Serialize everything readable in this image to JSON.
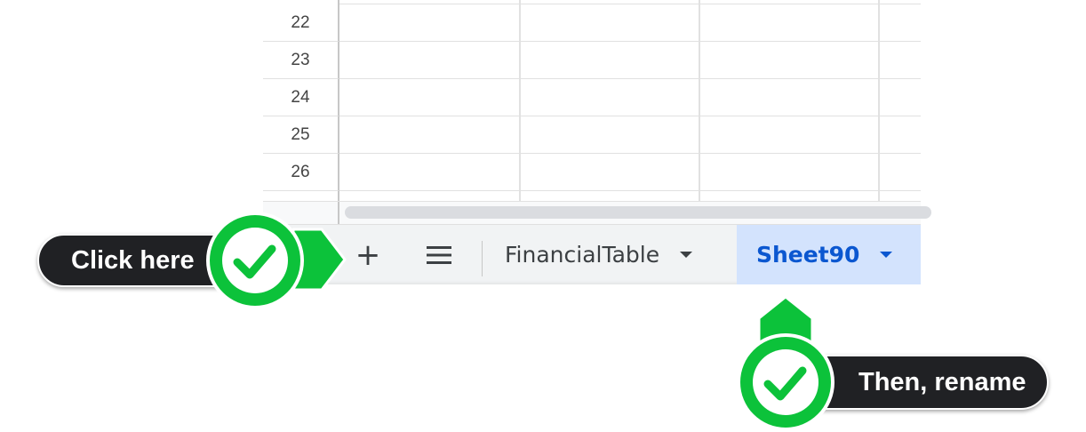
{
  "grid": {
    "rows": [
      {
        "number": "22"
      },
      {
        "number": "23"
      },
      {
        "number": "24"
      },
      {
        "number": "25"
      },
      {
        "number": "26"
      }
    ]
  },
  "tabbar": {
    "add_label": "+",
    "tabs": [
      {
        "label": "FinancialTable",
        "active": false
      },
      {
        "label": "Sheet90",
        "active": true
      }
    ]
  },
  "annotations": {
    "step1": "Click here",
    "step2": "Then, rename"
  },
  "colors": {
    "active_tab_bg": "#d3e3fd",
    "active_tab_text": "#0b57d0",
    "callout_green": "#0cc23a",
    "callout_dark": "#202124"
  },
  "icons": [
    "add-sheet-icon",
    "all-sheets-menu-icon",
    "chevron-down-icon",
    "checkmark-icon"
  ]
}
